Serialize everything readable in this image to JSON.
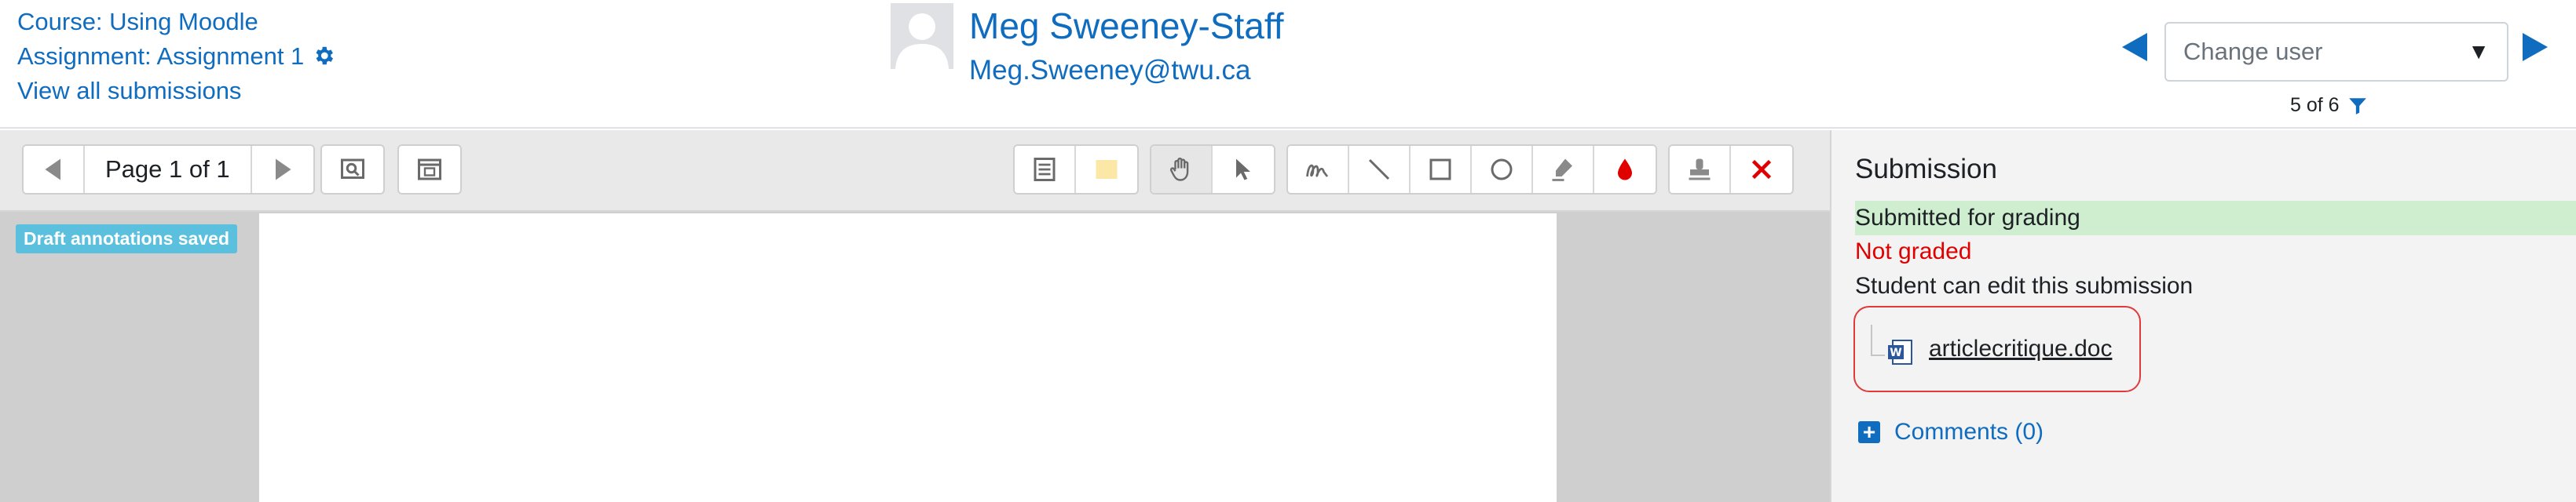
{
  "header": {
    "course": "Course: Using Moodle",
    "assignment": "Assignment: Assignment 1",
    "view_all": "View all submissions",
    "user_name": "Meg Sweeney-Staff",
    "user_email": "Meg.Sweeney@twu.ca",
    "change_user_placeholder": "Change user",
    "counter": "5 of 6"
  },
  "toolbar": {
    "page_label": "Page 1 of 1",
    "icons": [
      "prev-page-icon",
      "next-page-icon",
      "search-comments-icon",
      "expand-view-icon",
      "comment-bank-icon",
      "comment-color-icon",
      "pan-icon",
      "select-icon",
      "pen-icon",
      "line-icon",
      "rectangle-icon",
      "oval-icon",
      "highlight-icon",
      "annotation-color-icon",
      "stamp-icon",
      "delete-icon"
    ],
    "annotation_color": "#e00000"
  },
  "viewer": {
    "badge": "Draft annotations saved"
  },
  "submission": {
    "title": "Submission",
    "status": "Submitted for grading",
    "grading_status": "Not graded",
    "edit_status": "Student can edit this submission",
    "file_name": "articlecritique.doc",
    "comments_label": "Comments (0)"
  },
  "colors": {
    "link": "#0f6cbf",
    "submitted_bg": "#cfeecf",
    "not_graded": "#e00000",
    "badge_bg": "#5bc0de",
    "highlight_box": "#e03a3a"
  }
}
